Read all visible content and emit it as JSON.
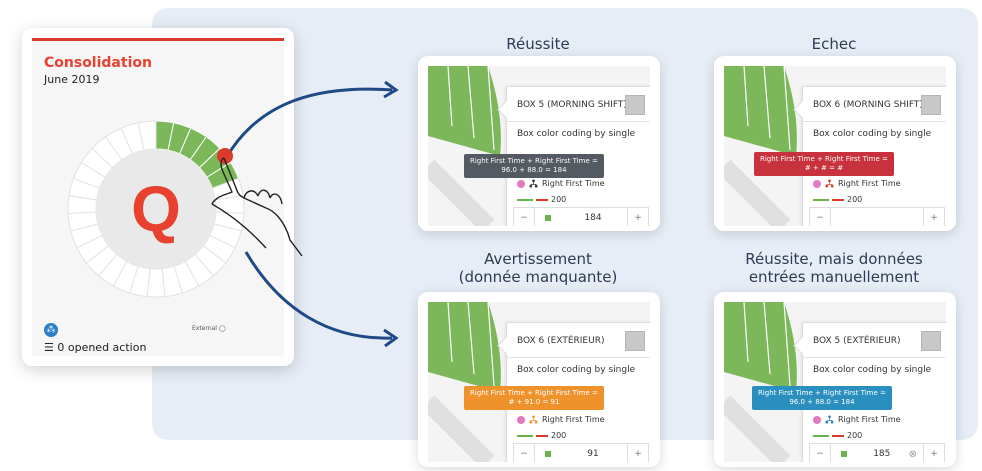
{
  "card": {
    "title": "Consolidation",
    "date": "June 2019",
    "letter": "Q",
    "actions": "0 opened action",
    "external": "External"
  },
  "panels": [
    {
      "label_line1": "Réussite",
      "label_line2": "",
      "box": "BOX 5 (MORNING SHIFT)",
      "desc": "Box color coding by single",
      "tip_line1": "Right First Time + Right First Time =",
      "tip_line2": "96.0 + 88.0 = 184",
      "tip_color": "#545a62",
      "rft": "Right First Time",
      "target": "200",
      "value": "184",
      "minus": "−",
      "plus": "+",
      "tree_color": "#333333",
      "show_square": true,
      "show_clear": false
    },
    {
      "label_line1": "Echec",
      "label_line2": "",
      "box": "BOX 6 (MORNING SHIFT)",
      "desc": "Box color coding by single",
      "tip_line1": "Right First Time + Right First Time =",
      "tip_line2": "# + # = #",
      "tip_color": "#c7323c",
      "rft": "Right First Time",
      "target": "200",
      "value": "",
      "minus": "−",
      "plus": "+",
      "tree_color": "#d93a2b",
      "show_square": false,
      "show_clear": false
    },
    {
      "label_line1": "Avertissement",
      "label_line2": "(donnée manquante)",
      "box": "BOX 6 (EXTÉRIEUR)",
      "desc": "Box color coding by single",
      "tip_line1": "Right First Time + Right First Time =",
      "tip_line2": "# + 91.0 = 91",
      "tip_color": "#f0922b",
      "rft": "Right First Time",
      "target": "200",
      "value": "91",
      "minus": "−",
      "plus": "+",
      "tree_color": "#f0922b",
      "show_square": true,
      "show_clear": false
    },
    {
      "label_line1": "Réussite, mais données",
      "label_line2": "entrées manuellement",
      "box": "BOX 5 (EXTÉRIEUR)",
      "desc": "Box color coding by single",
      "tip_line1": "Right First Time + Right First Time =",
      "tip_line2": "96.0 + 88.0 = 184",
      "tip_color": "#2a8fbf",
      "rft": "Right First Time",
      "target": "200",
      "value": "185",
      "clear": "⊗",
      "minus": "−",
      "plus": "+",
      "tree_color": "#2c7fc7",
      "show_square": true,
      "show_clear": true
    }
  ],
  "colors": {
    "accent_red": "#e8412f",
    "green": "#7cb85a",
    "panel_bg": "#e6edf6",
    "arrow": "#1f4a86"
  }
}
